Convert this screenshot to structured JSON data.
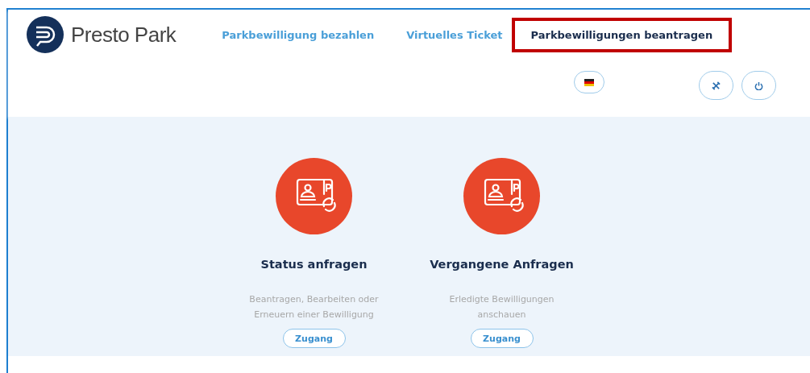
{
  "brand": {
    "name": "Presto Park"
  },
  "nav": [
    {
      "label": "Parkbewilligung bezahlen",
      "selected": false
    },
    {
      "label": "Virtuelles Ticket",
      "selected": false
    },
    {
      "label": "Parkbewilligungen beantragen",
      "selected": true
    }
  ],
  "cards": [
    {
      "title": "Status anfragen",
      "description": "Beantragen, Bearbeiten oder Erneuern einer Bewilligung",
      "button": "Zugang"
    },
    {
      "title": "Vergangene Anfragen",
      "description": "Erledigte Bewilligungen anschauen",
      "button": "Zugang"
    }
  ]
}
